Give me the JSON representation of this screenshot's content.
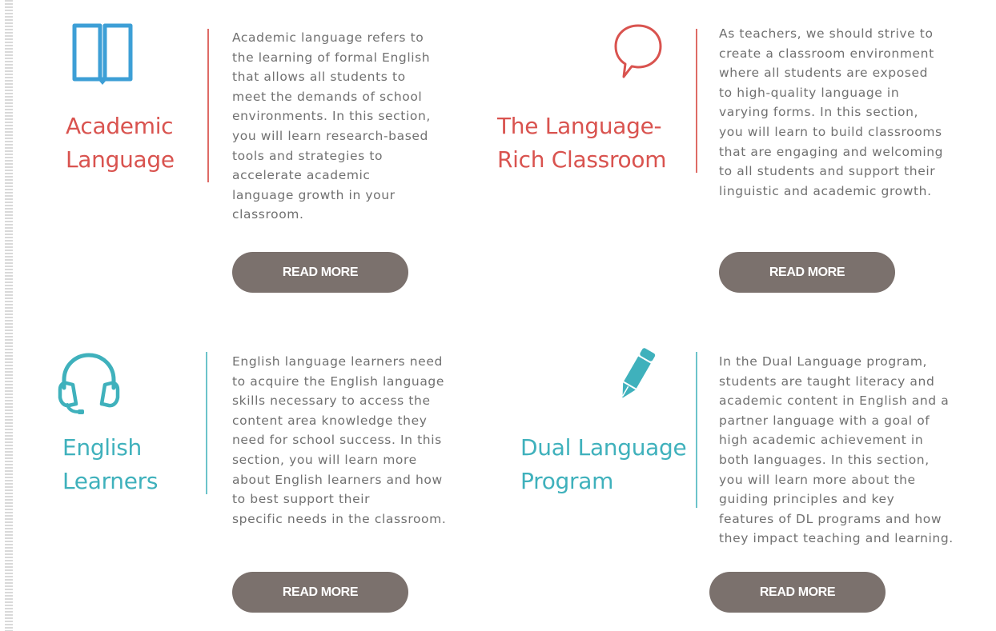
{
  "sections": [
    {
      "icon": "open-book-icon",
      "title_line1": "Academic",
      "title_line2": "Language",
      "description": "Academic language refers to\nthe learning of formal English\nthat allows all students to\nmeet the demands of school\nenvironments. In this section,\nyou will learn research-based\ntools and strategies to\naccelerate academic\nlanguage growth in your\nclassroom.",
      "button_label": "READ MORE",
      "accent_color": "#d9534f"
    },
    {
      "icon": "speech-bubble-icon",
      "title_line1": "The Language-",
      "title_line2": "Rich Classroom",
      "description": "As teachers, we should strive to\ncreate a classroom environment\nwhere all students are exposed\nto high-quality language in\nvarying forms. In this section,\nyou will learn to build classrooms\nthat are engaging and welcoming\nto all students and support their\nlinguistic and academic growth.",
      "button_label": "READ MORE",
      "accent_color": "#d9534f"
    },
    {
      "icon": "headphones-icon",
      "title_line1": "English",
      "title_line2": "Learners",
      "description": "English language learners need\nto acquire the English language\nskills necessary to access the\ncontent area knowledge they\nneed for school success. In this\nsection, you will learn more\nabout English learners and how\nto best support their\nspecific needs in the classroom.",
      "button_label": "READ MORE",
      "accent_color": "#3fb1bc"
    },
    {
      "icon": "pencil-icon",
      "title_line1": "Dual Language",
      "title_line2": "Program",
      "description": "In the Dual Language program,\nstudents are taught literacy and\nacademic content in English and a\npartner language with a goal of\nhigh academic achievement in\nboth languages. In this section,\nyou will learn more about the\nguiding principles and key\nfeatures of DL programs and how\nthey impact teaching and learning.",
      "button_label": "READ MORE",
      "accent_color": "#3fb1bc"
    }
  ],
  "button_color": "#7b716d"
}
